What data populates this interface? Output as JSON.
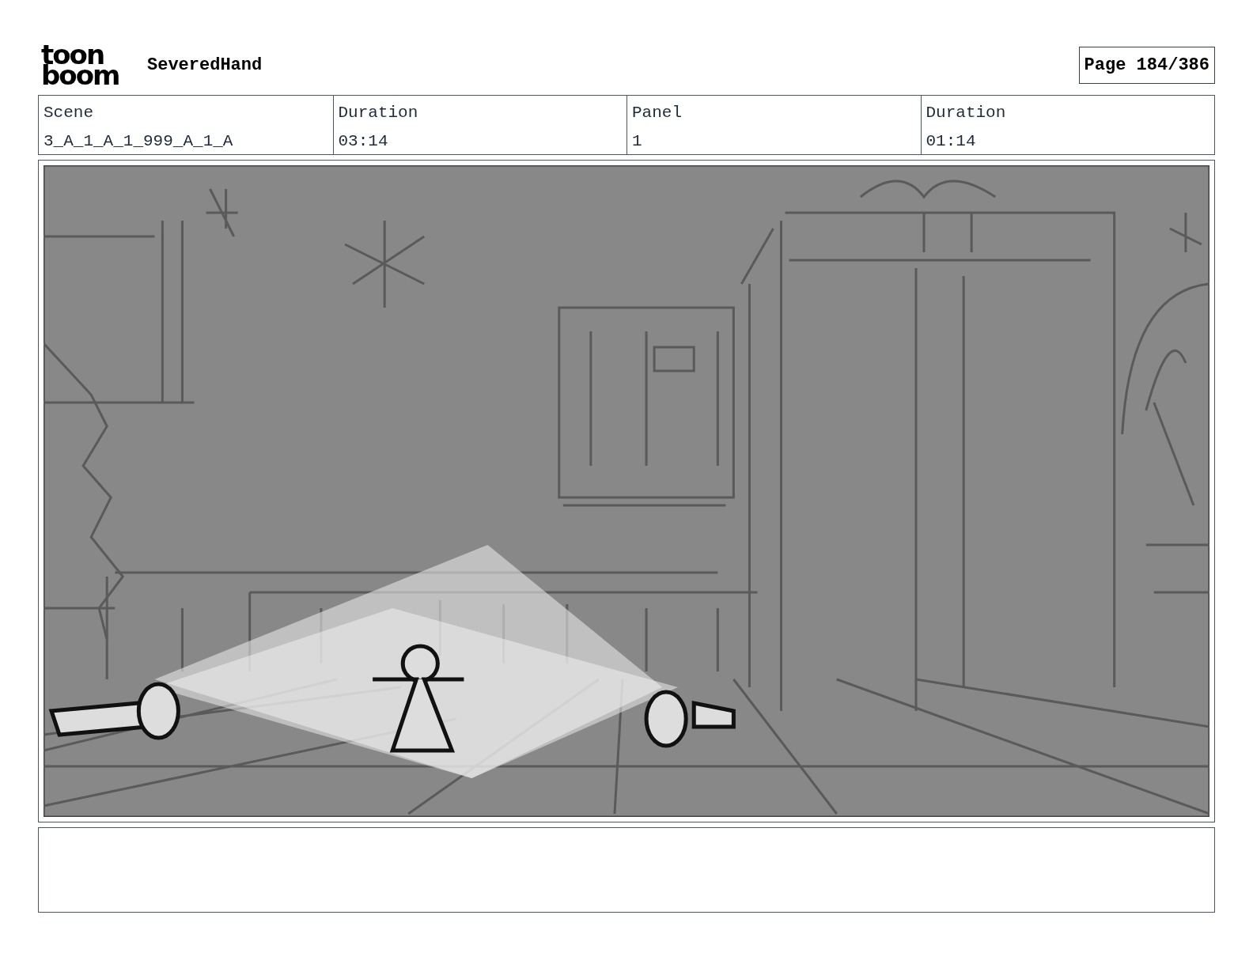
{
  "header": {
    "logo": [
      "toon",
      "boom"
    ],
    "project": "SeveredHand",
    "page": "Page 184/386"
  },
  "info": [
    {
      "label": "Scene",
      "value": "3_A_1_A_1_999_A_1_A"
    },
    {
      "label": "Duration",
      "value": "03:14"
    },
    {
      "label": "Panel",
      "value": "1"
    },
    {
      "label": "Duration",
      "value": "01:14"
    }
  ]
}
